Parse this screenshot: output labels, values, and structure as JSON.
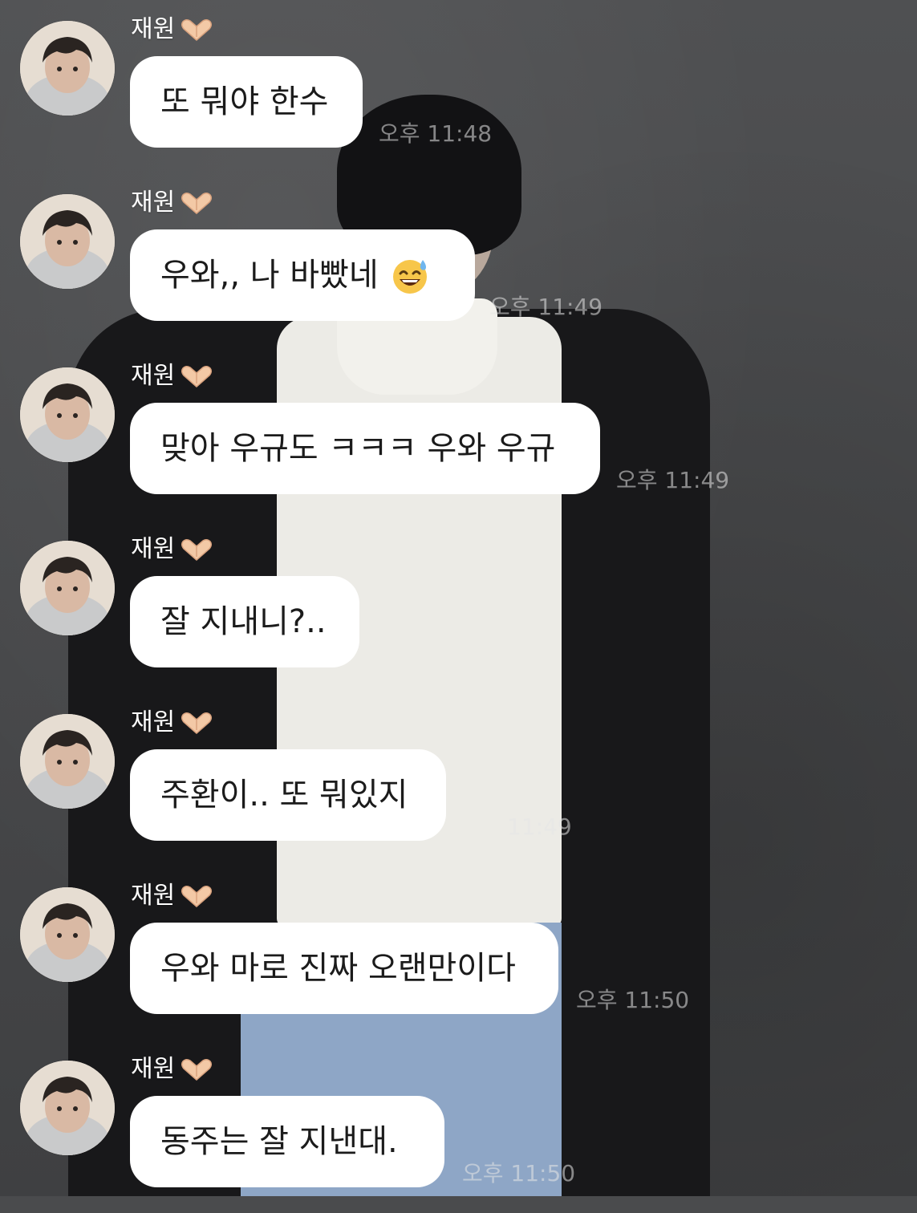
{
  "chat": {
    "messages": [
      {
        "sender": "재원",
        "text": "또 뭐야 한수",
        "time": "오후 11:48"
      },
      {
        "sender": "재원",
        "text": "우와,, 나 바빴네",
        "emoji": "sweat-smile-emoji",
        "time": "오후 11:49"
      },
      {
        "sender": "재원",
        "text": "맞아 우규도 ㅋㅋㅋ 우와 우규",
        "time": "오후 11:49"
      },
      {
        "sender": "재원",
        "text": "잘 지내니?..",
        "time": ""
      },
      {
        "sender": "재원",
        "text": "주환이.. 또 뭐있지",
        "time": "11:49"
      },
      {
        "sender": "재원",
        "text": "우와 마로 진짜 오랜만이다",
        "time": "오후 11:50"
      },
      {
        "sender": "재원",
        "text": "동주는 잘 지낸대.",
        "time": "오후 11:50"
      }
    ]
  },
  "colors": {
    "bubble": "#ffffff",
    "bubble_text": "#1b1b1b",
    "sender_text": "#ffffff",
    "heart": "#f3c9a6"
  },
  "icons": {
    "sender_badge": "finger-heart-hands-icon",
    "avatar": "profile-avatar-icon"
  }
}
